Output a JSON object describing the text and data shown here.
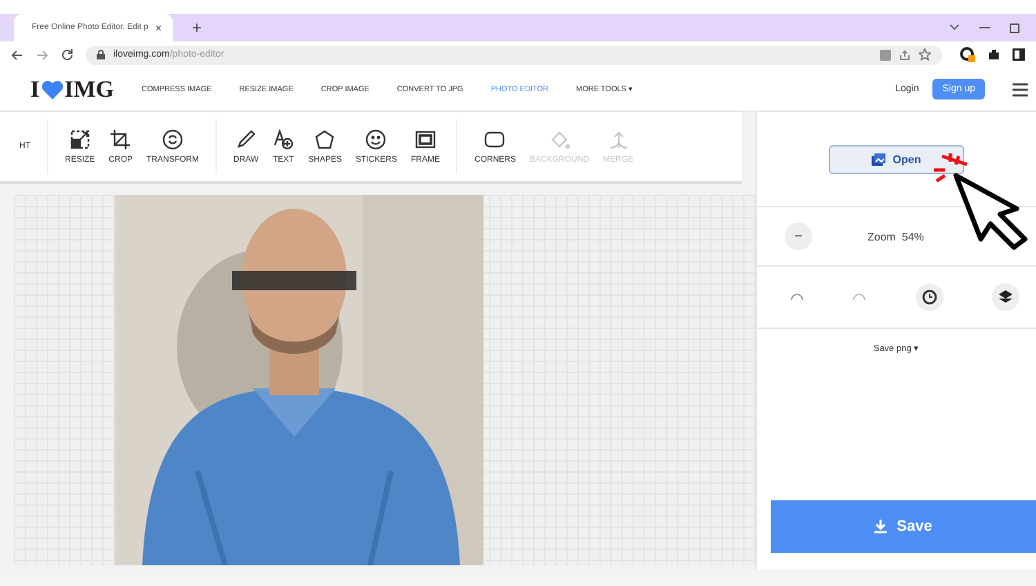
{
  "browser": {
    "tab_title": "Free Online Photo Editor. Edit p",
    "tab_close": "×",
    "new_tab": "+",
    "url_host": "iloveimg.com",
    "url_path": "/photo-editor"
  },
  "site": {
    "logo_left": "I",
    "logo_right": "IMG",
    "nav": [
      {
        "label": "COMPRESS IMAGE",
        "selected": false
      },
      {
        "label": "RESIZE IMAGE",
        "selected": false
      },
      {
        "label": "CROP IMAGE",
        "selected": false
      },
      {
        "label": "CONVERT TO JPG",
        "selected": false
      },
      {
        "label": "PHOTO EDITOR",
        "selected": true
      },
      {
        "label": "MORE TOOLS ▾",
        "selected": false
      }
    ],
    "login": "Login",
    "signup": "Sign up"
  },
  "toolbar": {
    "cut_label": "HT",
    "groups": [
      [
        {
          "kind": "resize",
          "label": "RESIZE",
          "disabled": false
        },
        {
          "kind": "crop",
          "label": "CROP",
          "disabled": false
        },
        {
          "kind": "transform",
          "label": "TRANSFORM",
          "disabled": false
        }
      ],
      [
        {
          "kind": "draw",
          "label": "DRAW",
          "disabled": false
        },
        {
          "kind": "text",
          "label": "TEXT",
          "disabled": false
        },
        {
          "kind": "shapes",
          "label": "SHAPES",
          "disabled": false
        },
        {
          "kind": "stickers",
          "label": "STICKERS",
          "disabled": false
        },
        {
          "kind": "frame",
          "label": "FRAME",
          "disabled": false
        }
      ],
      [
        {
          "kind": "corners",
          "label": "CORNERS",
          "disabled": false
        },
        {
          "kind": "background",
          "label": "BACKGROUND",
          "disabled": true
        },
        {
          "kind": "merge",
          "label": "MERGE",
          "disabled": true
        }
      ]
    ]
  },
  "panel": {
    "open": "Open",
    "zoom_out": "−",
    "zoom": "Zoom  54%",
    "save_format": "Save png ▾",
    "save": "Save"
  }
}
